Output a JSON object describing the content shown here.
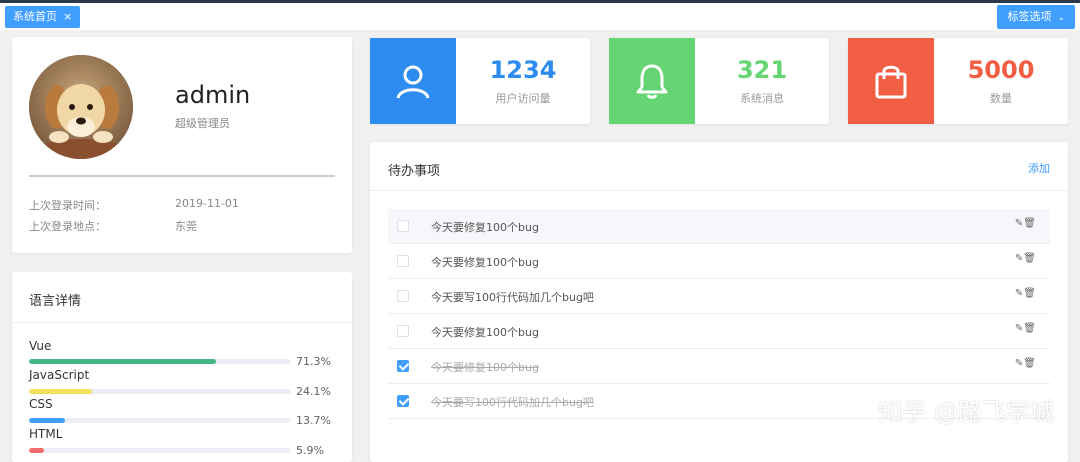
{
  "tabs": {
    "active_label": "系统首页",
    "close_glyph": "×",
    "options_label": "标签选项",
    "options_chevron": "⌄"
  },
  "user": {
    "name": "admin",
    "role": "超级管理员",
    "last_login_time_label": "上次登录时间：",
    "last_login_time": "2019-11-01",
    "last_login_place_label": "上次登录地点：",
    "last_login_place": "东莞"
  },
  "languages": {
    "title": "语言详情",
    "items": [
      {
        "name": "Vue",
        "percent": "71.3%",
        "value": 71.3,
        "color": "#42b983"
      },
      {
        "name": "JavaScript",
        "percent": "24.1%",
        "value": 24.1,
        "color": "#f1e05a"
      },
      {
        "name": "CSS",
        "percent": "13.7%",
        "value": 13.7,
        "color": "#409eff"
      },
      {
        "name": "HTML",
        "percent": "5.9%",
        "value": 5.9,
        "color": "#f56c6c"
      }
    ]
  },
  "stats": [
    {
      "number": "1234",
      "label": "用户访问量",
      "icon": "user-icon",
      "color": "#2d8cf0"
    },
    {
      "number": "321",
      "label": "系统消息",
      "icon": "bell-icon",
      "color": "#64d572"
    },
    {
      "number": "5000",
      "label": "数量",
      "icon": "bag-icon",
      "color": "#f25e43"
    }
  ],
  "todo": {
    "title": "待办事项",
    "add_label": "添加",
    "ops": "✎🗑",
    "items": [
      {
        "text": "今天要修复100个bug",
        "done": false
      },
      {
        "text": "今天要修复100个bug",
        "done": false
      },
      {
        "text": "今天要写100行代码加几个bug吧",
        "done": false
      },
      {
        "text": "今天要修复100个bug",
        "done": false
      },
      {
        "text": "今天要修复100个bug",
        "done": true
      },
      {
        "text": "今天要写100行代码加几个bug吧",
        "done": true
      }
    ]
  },
  "watermark": "知乎 @路飞学城"
}
